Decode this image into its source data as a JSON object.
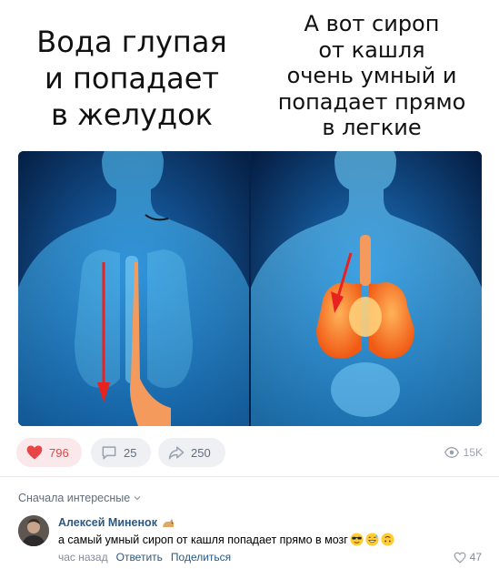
{
  "meme": {
    "left_caption": [
      "Вода глупая",
      "и попадает",
      "в желудок"
    ],
    "right_caption": [
      "А вот сироп",
      "от кашля",
      "очень умный и",
      "попадает прямо",
      "в легкие"
    ]
  },
  "actions": {
    "likes": "796",
    "comments": "25",
    "shares": "250",
    "views": "15K",
    "like_color": "#e64646"
  },
  "comments_section": {
    "sort_label": "Сначала интересные",
    "comment": {
      "author": "Алексей Миненок",
      "text": "а самый умный сироп от кашля попадает прямо в мозг",
      "emojis": [
        "smiling-face-with-sunglasses",
        "grinning-face-with-sweat",
        "upside-down-face"
      ],
      "time": "час назад",
      "reply_label": "Ответить",
      "share_label": "Поделиться",
      "likes": "47"
    }
  },
  "colors": {
    "link": "#2a5885",
    "secondary_text": "#818c99",
    "pill_background": "#eef0f3"
  }
}
